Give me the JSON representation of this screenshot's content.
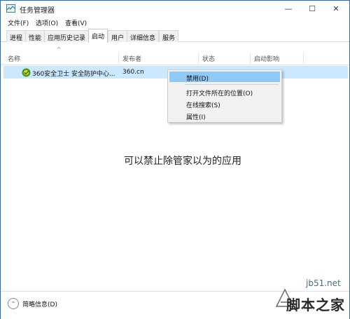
{
  "window": {
    "title": "任务管理器"
  },
  "window_controls": {
    "minimize": "—",
    "maximize": "☐",
    "close": "✕"
  },
  "menu": {
    "items": [
      "文件(F)",
      "选项(O)",
      "查看(V)"
    ]
  },
  "tabs": {
    "items": [
      "进程",
      "性能",
      "应用历史记录",
      "启动",
      "用户",
      "详细信息",
      "服务"
    ],
    "active": "启动"
  },
  "columns": {
    "name": "名称",
    "publisher": "发布者",
    "status": "状态",
    "impact": "启动影响"
  },
  "startup_rows": [
    {
      "name": "360安全卫士 安全防护中心...",
      "publisher": "360.cn",
      "status": "",
      "impact": ""
    }
  ],
  "context_menu": {
    "items": [
      "禁用(D)",
      "打开文件所在的位置(O)",
      "在线搜索(S)",
      "属性(I)"
    ],
    "highlighted": "禁用(D)"
  },
  "annotation": {
    "text": "可以禁止除管家以为的应用"
  },
  "footer": {
    "fewer_details_label": "简略信息(D)"
  },
  "watermark": {
    "url": "jb51.net",
    "brand": "脚本之家"
  },
  "colors": {
    "selection": "#cce8ff",
    "menu_highlight": "#90c8f6",
    "border_accent": "#1c6fc4"
  }
}
